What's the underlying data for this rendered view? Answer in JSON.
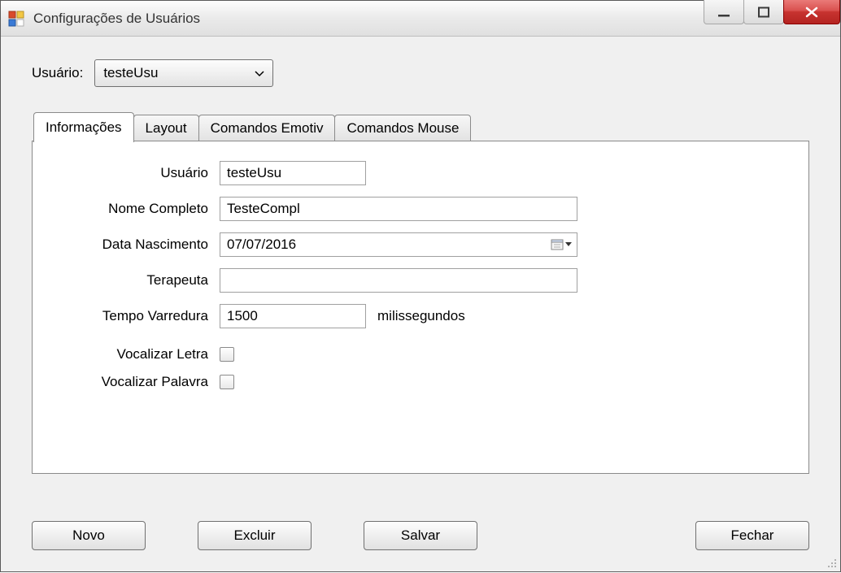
{
  "window": {
    "title": "Configurações de Usuários"
  },
  "userSelector": {
    "label": "Usuário:",
    "value": "testeUsu"
  },
  "tabs": {
    "informacoes": "Informações",
    "layout": "Layout",
    "comandosEmotiv": "Comandos Emotiv",
    "comandosMouse": "Comandos Mouse"
  },
  "form": {
    "usuario": {
      "label": "Usuário",
      "value": "testeUsu"
    },
    "nomeCompleto": {
      "label": "Nome Completo",
      "value": "TesteCompl"
    },
    "dataNascimento": {
      "label": "Data Nascimento",
      "value": "07/07/2016"
    },
    "terapeuta": {
      "label": "Terapeuta",
      "value": ""
    },
    "tempoVarredura": {
      "label": "Tempo Varredura",
      "value": "1500",
      "unit": "milissegundos"
    },
    "vocalizarLetra": {
      "label": "Vocalizar Letra",
      "checked": false
    },
    "vocalizarPalavra": {
      "label": "Vocalizar Palavra",
      "checked": false
    }
  },
  "buttons": {
    "novo": "Novo",
    "excluir": "Excluir",
    "salvar": "Salvar",
    "fechar": "Fechar"
  }
}
